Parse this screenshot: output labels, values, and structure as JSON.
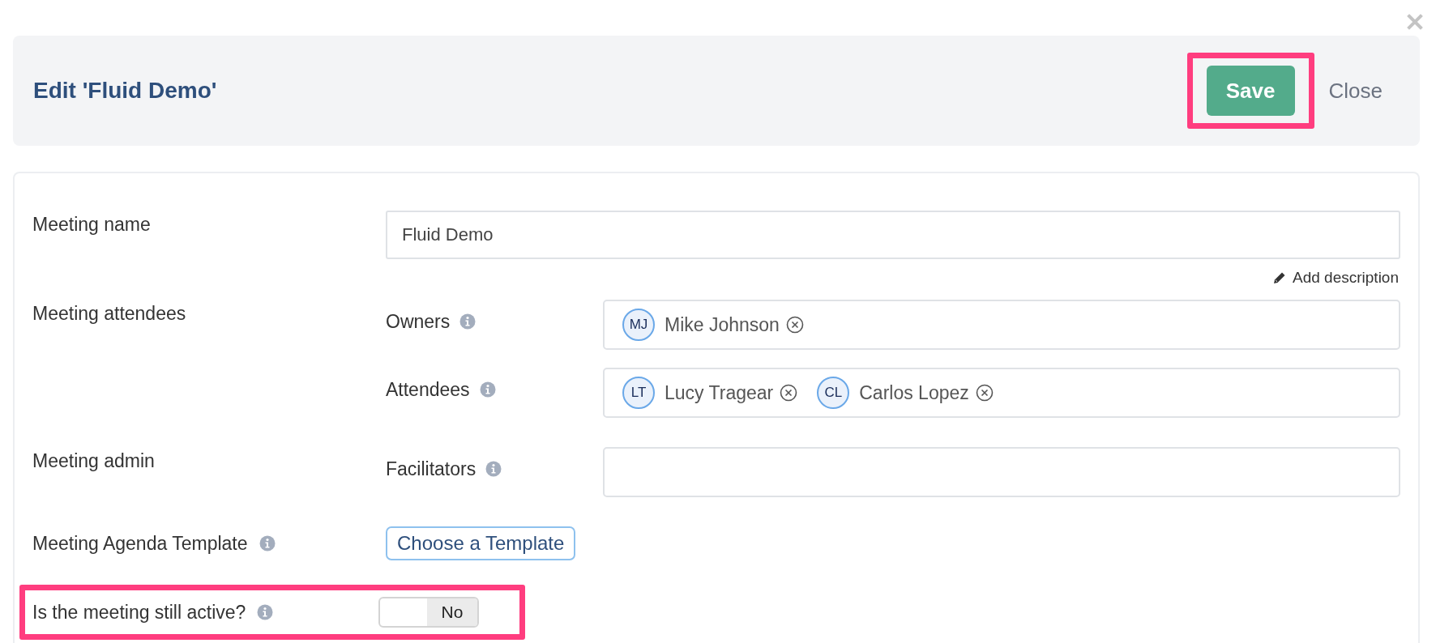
{
  "header": {
    "title": "Edit 'Fluid Demo'",
    "save_label": "Save",
    "save_highlighted": true,
    "close_label": "Close"
  },
  "form": {
    "name_row": {
      "label": "Meeting name",
      "value": "Fluid Demo",
      "add_description": "Add description"
    },
    "attendees_row": {
      "label": "Meeting attendees",
      "groups": [
        {
          "label": "Owners",
          "people": [
            {
              "initials": "MJ",
              "name": "Mike Johnson"
            }
          ]
        },
        {
          "label": "Attendees",
          "people": [
            {
              "initials": "LT",
              "name": "Lucy Tragear"
            },
            {
              "initials": "CL",
              "name": "Carlos Lopez"
            }
          ]
        }
      ]
    },
    "admin_row": {
      "label": "Meeting admin",
      "groups": [
        {
          "label": "Facilitators"
        }
      ]
    },
    "template_row": {
      "label": "Meeting Agenda Template",
      "button": "Choose a Template"
    },
    "active_row": {
      "label": "Is the meeting still active?",
      "on": false,
      "toggle_text": "No",
      "highlighted": true
    }
  }
}
